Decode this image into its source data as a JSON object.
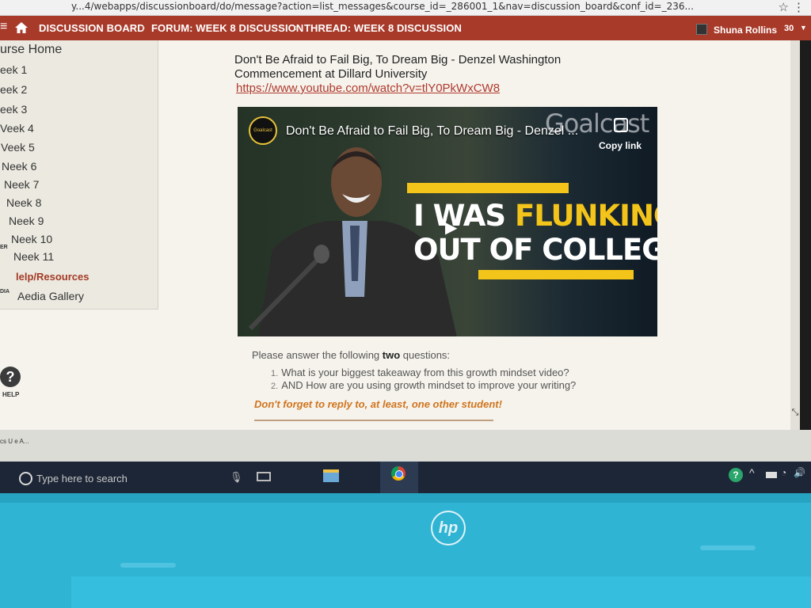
{
  "browser": {
    "url_fragment": "y...4/webapps/discussionboard/do/message?action=list_messages&course_id=_286001_1&nav=discussion_board&conf_id=_236..."
  },
  "nav": {
    "breadcrumbs": [
      "DISCUSSION BOARD",
      "FORUM: WEEK 8 DISCUSSION",
      "THREAD: WEEK 8 DISCUSSION"
    ],
    "user_name": "Shuna Rollins",
    "notification_count": "30"
  },
  "sidebar": {
    "items": [
      {
        "label": "urse Home"
      },
      {
        "label": "eek 1"
      },
      {
        "label": "eek 2"
      },
      {
        "label": "eek 3"
      },
      {
        "label": "Veek 4"
      },
      {
        "label": "Veek 5"
      },
      {
        "label": "Neek 6"
      },
      {
        "label": "Neek 7"
      },
      {
        "label": "Neek 8"
      },
      {
        "label": "Neek 9"
      },
      {
        "label": "Neek 10"
      },
      {
        "label": "Neek 11"
      },
      {
        "label": "lelp/Resources"
      },
      {
        "label": "Aedia Gallery"
      }
    ],
    "side_tags": [
      "ER",
      "DIA"
    ],
    "help_label": "HELP"
  },
  "post": {
    "title": "Don't Be Afraid to Fail Big, To Dream Big - Denzel Washington Commencement at Dillard University",
    "link": "https://www.youtube.com/watch?v=tlY0PkWxCW8",
    "video": {
      "channel": "Goalcast",
      "title": "Don't Be Afraid to Fail Big, To Dream Big - Denzel ...",
      "watermark": "Goalcast",
      "copy_link_label": "Copy link",
      "headline_white_1": "I WAS ",
      "headline_yellow_1": "FLUNKING",
      "headline_white_2": "OUT OF COLLEGE",
      "colors": {
        "accent": "#f3c419"
      }
    },
    "prompt_prefix": "Please answer the following ",
    "prompt_bold": "two",
    "prompt_suffix": " questions:",
    "questions": [
      {
        "num": "1.",
        "text": "What is your biggest takeaway from this growth mindset video?"
      },
      {
        "num": "2.",
        "text": "AND How are you using growth mindset to improve your writing?"
      }
    ],
    "reminder": "Don't forget to reply to, at least, one other student!"
  },
  "desktop": {
    "label": "cs U\ne A..."
  },
  "taskbar": {
    "search_placeholder": "Type here to search",
    "tray_help": "?"
  },
  "laptop": {
    "brand": "hp"
  },
  "colors": {
    "nav_red": "#a83a2a",
    "link_red": "#b03a2e",
    "reminder_orange": "#d1741e",
    "taskbar": "#1d2636",
    "laptop_cyan": "#2fb4d4"
  }
}
